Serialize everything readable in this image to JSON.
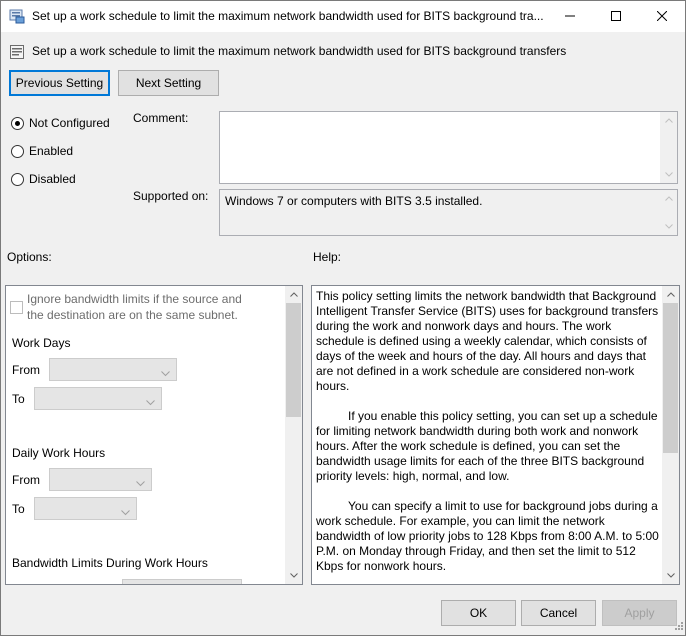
{
  "window": {
    "title": "Set up a work schedule to limit the maximum network bandwidth used for BITS background tra...",
    "minimize_glyph": "—",
    "maximize_glyph": "☐",
    "close_glyph": "✕"
  },
  "header": {
    "title": "Set up a work schedule to limit the maximum network bandwidth used for BITS background transfers"
  },
  "nav": {
    "previous_label": "Previous Setting",
    "next_label": "Next Setting"
  },
  "state": {
    "options": [
      {
        "label": "Not Configured",
        "checked": true
      },
      {
        "label": "Enabled",
        "checked": false
      },
      {
        "label": "Disabled",
        "checked": false
      }
    ]
  },
  "comment": {
    "label": "Comment:",
    "value": ""
  },
  "supported": {
    "label": "Supported on:",
    "value": "Windows 7 or computers with BITS 3.5 installed."
  },
  "options_panel": {
    "label": "Options:",
    "ignore_checkbox_label_line1": "Ignore bandwidth limits if the source and",
    "ignore_checkbox_label_line2": "the destination are on the same subnet.",
    "work_days_label": "Work Days",
    "from_label": "From",
    "to_label": "To",
    "daily_hours_label": "Daily Work Hours",
    "from2_label": "From",
    "to2_label": "To",
    "bandwidth_label": "Bandwidth Limits During Work Hours"
  },
  "help_panel": {
    "label": "Help:",
    "paragraphs": [
      "This policy setting limits the network bandwidth that Background Intelligent Transfer Service (BITS) uses for background transfers during the work and nonwork days and hours. The work schedule is defined using a weekly calendar, which consists of days of the week and hours of the day. All hours and days that are not defined in a work schedule are considered non-work hours.",
      "If you enable this policy setting, you can set up a schedule for limiting network bandwidth during both work and nonwork hours. After the work schedule is defined, you can set the bandwidth usage limits for each of the three BITS background priority levels: high, normal, and low.",
      "You can specify a limit to use for background jobs during a work schedule. For example, you can limit the network bandwidth of low priority jobs to 128 Kbps from 8:00 A.M. to 5:00 P.M. on Monday through Friday, and then set the limit to 512 Kbps for nonwork hours."
    ]
  },
  "footer": {
    "ok_label": "OK",
    "cancel_label": "Cancel",
    "apply_label": "Apply"
  }
}
